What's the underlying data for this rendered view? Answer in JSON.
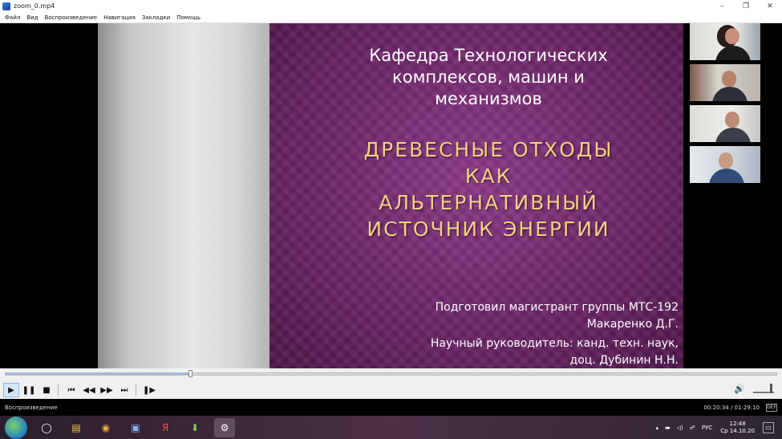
{
  "window": {
    "title": "zoom_0.mp4",
    "minimize": "–",
    "maximize": "❐",
    "close": "✕"
  },
  "menu": [
    "Файл",
    "Вид",
    "Воспроизведение",
    "Навигация",
    "Закладки",
    "Помощь"
  ],
  "slide": {
    "dept_lines": [
      "Кафедра Технологических",
      "комплексов, машин и",
      "механизмов"
    ],
    "topic_lines": [
      "ДРЕВЕСНЫЕ ОТХОДЫ",
      "КАК",
      "АЛЬТЕРНАТИВНЫЙ",
      "ИСТОЧНИК ЭНЕРГИИ"
    ],
    "author_lines": [
      "Подготовил магистрант группы МТС-192",
      "Макаренко Д.Г."
    ],
    "supervisor_lines": [
      "Научный руководитель: канд. техн. наук,",
      "доц. Дубинин Н.Н."
    ]
  },
  "playback": {
    "progress": 0.24
  },
  "controls": {
    "play": "▶",
    "pause": "❚❚",
    "stop": "■",
    "prev_chapter": "⏮",
    "rewind": "◀◀",
    "forward": "▶▶",
    "next_chapter": "⏭",
    "frame_step": "❚▶",
    "volume": "🔊"
  },
  "status": {
    "text": "Воспроизведение",
    "time": "00:20:34 / 01:29:10",
    "icon": "DEF"
  },
  "taskbar": {
    "apps": [
      "◯",
      "▤",
      "◉",
      "▣",
      "Я",
      "⬇",
      "⚙"
    ],
    "tray_icons": [
      "▴",
      "▬",
      "◁)",
      "☍",
      "РУС"
    ],
    "clock_time": "12:48",
    "clock_date": "Ср 14.10.20",
    "desktop": "▭"
  },
  "colors": {
    "slide_purple": "#6b2467",
    "topic_gold": "#f3d184"
  }
}
